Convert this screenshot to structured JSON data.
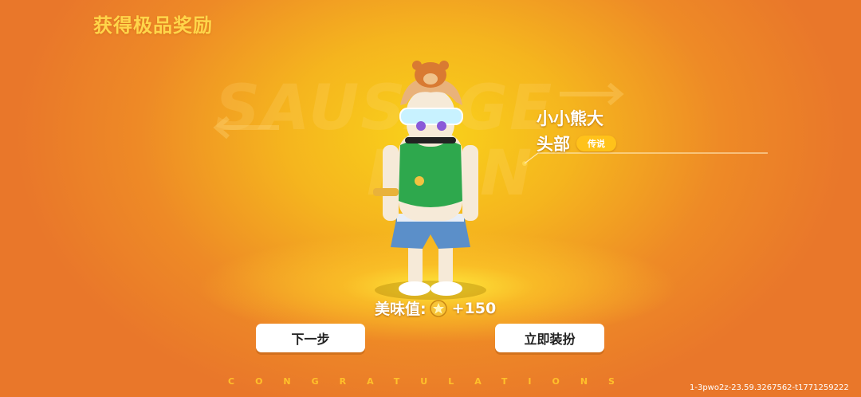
{
  "screen": {
    "title": "获得极品奖励",
    "background_wordmark": [
      "SAUSAGE",
      "MAN"
    ],
    "footer_banner": "CONGRATULATIONS",
    "session_id": "1-3pwo2z-23.59.3267562-t1771259222"
  },
  "item": {
    "name": "小小熊大",
    "slot": "头部",
    "rarity": "传说",
    "rarity_color": "#ffc21a"
  },
  "score": {
    "label": "美味值:",
    "icon": "star-badge-icon",
    "value": "+150"
  },
  "buttons": {
    "next_label": "下一步",
    "equip_label": "立即装扮"
  },
  "colors": {
    "accent_yellow": "#ffd54a",
    "background_orange": "#ee8a26",
    "button_bg": "#ffffff"
  }
}
